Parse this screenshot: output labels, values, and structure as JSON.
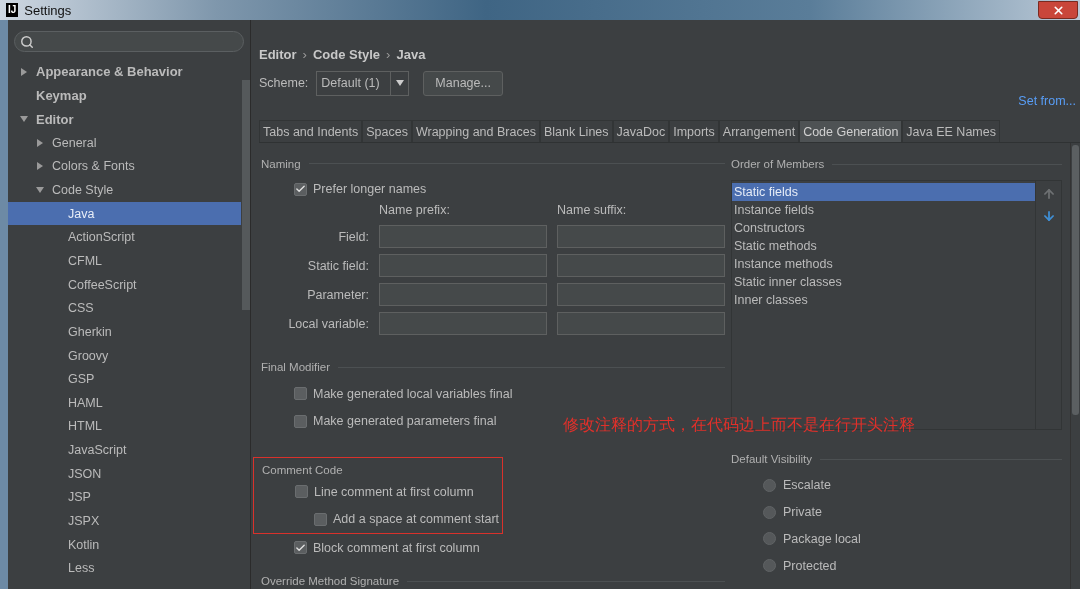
{
  "window": {
    "logo": "IJ",
    "title": "Settings"
  },
  "sidebar": {
    "tree": [
      {
        "label": "Appearance & Behavior",
        "kind": "folder",
        "expanded": false,
        "selected": false,
        "bold": true
      },
      {
        "label": "Keymap",
        "kind": "leaf",
        "selected": false,
        "bold": true
      },
      {
        "label": "Editor",
        "kind": "folder",
        "expanded": true,
        "selected": false,
        "bold": true,
        "children": [
          {
            "label": "General",
            "kind": "folder",
            "expanded": false,
            "selected": false
          },
          {
            "label": "Colors & Fonts",
            "kind": "folder",
            "expanded": false,
            "selected": false
          },
          {
            "label": "Code Style",
            "kind": "folder",
            "expanded": true,
            "selected": false,
            "children": [
              {
                "label": "Java",
                "kind": "leaf",
                "selected": true
              },
              {
                "label": "ActionScript",
                "kind": "leaf",
                "selected": false
              },
              {
                "label": "CFML",
                "kind": "leaf",
                "selected": false
              },
              {
                "label": "CoffeeScript",
                "kind": "leaf",
                "selected": false
              },
              {
                "label": "CSS",
                "kind": "leaf",
                "selected": false
              },
              {
                "label": "Gherkin",
                "kind": "leaf",
                "selected": false
              },
              {
                "label": "Groovy",
                "kind": "leaf",
                "selected": false
              },
              {
                "label": "GSP",
                "kind": "leaf",
                "selected": false
              },
              {
                "label": "HAML",
                "kind": "leaf",
                "selected": false
              },
              {
                "label": "HTML",
                "kind": "leaf",
                "selected": false
              },
              {
                "label": "JavaScript",
                "kind": "leaf",
                "selected": false
              },
              {
                "label": "JSON",
                "kind": "leaf",
                "selected": false
              },
              {
                "label": "JSP",
                "kind": "leaf",
                "selected": false
              },
              {
                "label": "JSPX",
                "kind": "leaf",
                "selected": false
              },
              {
                "label": "Kotlin",
                "kind": "leaf",
                "selected": false
              },
              {
                "label": "Less",
                "kind": "leaf",
                "selected": false
              }
            ]
          }
        ]
      }
    ]
  },
  "breadcrumb": [
    "Editor",
    "Code Style",
    "Java"
  ],
  "breadcrumb_separator": "›",
  "scheme": {
    "label": "Scheme:",
    "value": "Default (1)",
    "manage_button": "Manage...",
    "set_from_link": "Set from..."
  },
  "tabs": [
    {
      "label": "Tabs and Indents",
      "selected": false
    },
    {
      "label": "Spaces",
      "selected": false
    },
    {
      "label": "Wrapping and Braces",
      "selected": false
    },
    {
      "label": "Blank Lines",
      "selected": false
    },
    {
      "label": "JavaDoc",
      "selected": false
    },
    {
      "label": "Imports",
      "selected": false
    },
    {
      "label": "Arrangement",
      "selected": false
    },
    {
      "label": "Code Generation",
      "selected": true
    },
    {
      "label": "Java EE Names",
      "selected": false
    }
  ],
  "naming": {
    "title": "Naming",
    "prefer_longer": {
      "label": "Prefer longer names",
      "checked": true
    },
    "prefix_header": "Name prefix:",
    "suffix_header": "Name suffix:",
    "rows": [
      {
        "label": "Field:"
      },
      {
        "label": "Static field:"
      },
      {
        "label": "Parameter:"
      },
      {
        "label": "Local variable:"
      }
    ]
  },
  "final_modifier": {
    "title": "Final Modifier",
    "options": [
      {
        "label": "Make generated local variables final",
        "checked": false,
        "indented": false
      },
      {
        "label": "Make generated parameters final",
        "checked": false,
        "indented": false
      }
    ]
  },
  "comment_code": {
    "title": "Comment Code",
    "highlighted": true,
    "options": [
      {
        "label": "Line comment at first column",
        "checked": false,
        "indented": false
      },
      {
        "label": "Add a space at comment start",
        "checked": false,
        "indented": true
      },
      {
        "label": "Block comment at first column",
        "checked": true,
        "indented": false
      }
    ]
  },
  "override_section": {
    "title": "Override Method Signature"
  },
  "order_of_members": {
    "title": "Order of Members",
    "items": [
      {
        "label": "Static fields",
        "selected": true
      },
      {
        "label": "Instance fields",
        "selected": false
      },
      {
        "label": "Constructors",
        "selected": false
      },
      {
        "label": "Static methods",
        "selected": false
      },
      {
        "label": "Instance methods",
        "selected": false
      },
      {
        "label": "Static inner classes",
        "selected": false
      },
      {
        "label": "Inner classes",
        "selected": false
      }
    ]
  },
  "default_visibility": {
    "title": "Default Visibility",
    "options": [
      {
        "label": "Escalate",
        "selected": false
      },
      {
        "label": "Private",
        "selected": false
      },
      {
        "label": "Package local",
        "selected": false
      },
      {
        "label": "Protected",
        "selected": false
      }
    ]
  },
  "annotation": {
    "text": "修改注释的方式，在代码边上而不是在行开头注释"
  }
}
